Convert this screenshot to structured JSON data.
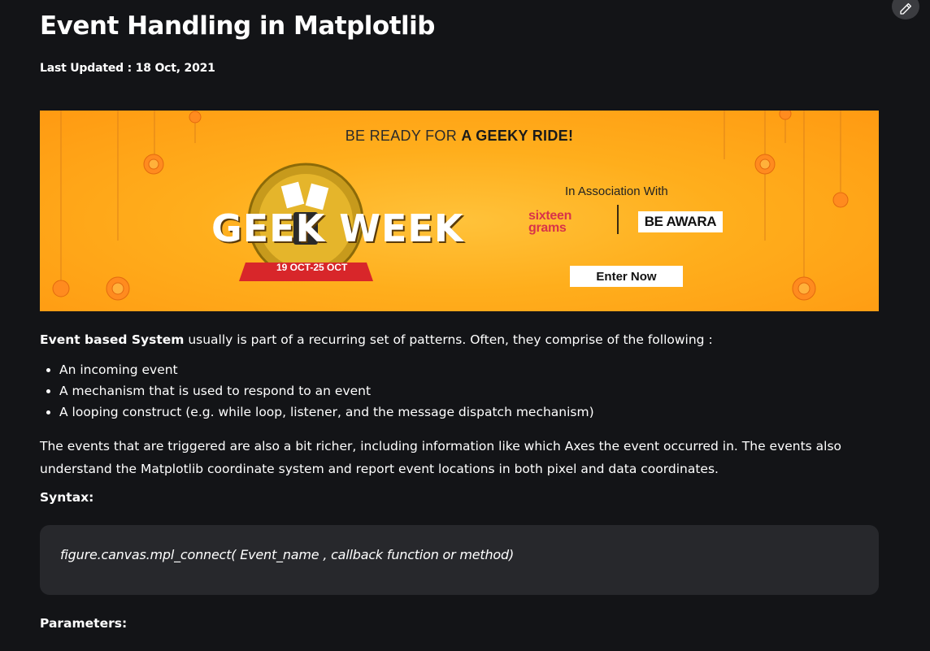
{
  "article": {
    "title": "Event Handling in Matplotlib",
    "last_updated": "Last Updated : 18 Oct, 2021"
  },
  "banner": {
    "headline_prefix": "BE READY FOR ",
    "headline_bold": "A GEEKY RIDE!",
    "association": "In Association With",
    "sponsor_1": "sixteen grams",
    "sponsor_2": "BE AWARA",
    "cta": "Enter Now",
    "logo_text": "GEEK WEEK",
    "logo_dates": "19 OCT-25 OCT",
    "bg_color": "#ffab1a"
  },
  "content": {
    "intro_bold": "Event based System",
    "intro_rest": " usually is part of a recurring set of patterns. Often, they comprise of the following :",
    "points": [
      "An incoming event",
      "A mechanism that is used to respond to an event",
      "A looping construct (e.g. while loop, listener, and the message dispatch mechanism)"
    ],
    "description": "The events that are triggered are also a bit richer, including information like which Axes the event occurred in. The events also understand the Matplotlib coordinate system and report event locations in both pixel and data coordinates.",
    "syntax_label": "Syntax:",
    "syntax_code": "figure.canvas.mpl_connect( Event_name , callback function or method)",
    "parameters_label": "Parameters:"
  },
  "icons": {
    "edit": "pencil-icon"
  },
  "theme": {
    "background": "#131417",
    "code_bg": "#27282c",
    "text": "#ffffff"
  }
}
